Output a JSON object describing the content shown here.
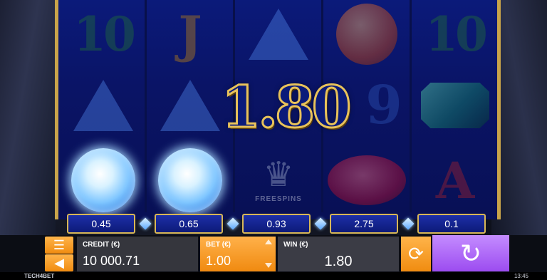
{
  "reels": [
    [
      "10",
      "gem-triangle-blue",
      "diamond"
    ],
    [
      "J",
      "gem-triangle-blue",
      "diamond"
    ],
    [
      "gem-triangle-blue",
      "",
      "crown-scatter"
    ],
    [
      "gem-round-orange",
      "9",
      "gem-oval-red"
    ],
    [
      "10",
      "gem-emerald-green",
      "A"
    ]
  ],
  "symbols": {
    "reel1_top": "10",
    "reel2_top": "J",
    "reel4_mid": "9",
    "reel5_top": "10",
    "reel5_bot": "A",
    "crown_text": "FREESPINS"
  },
  "win_display": "1.80",
  "reel_bets": [
    "0.45",
    "0.65",
    "0.93",
    "2.75",
    "0.1"
  ],
  "panel": {
    "credit_label": "CREDIT (€)",
    "credit_value": "10 000.71",
    "bet_label": "BET (€)",
    "bet_value": "1.00",
    "win_label": "WIN (€)",
    "win_value": "1.80"
  },
  "icons": {
    "menu": "☰",
    "sound": "◀",
    "autoplay": "⟳",
    "spin": "↻",
    "crown": "♛"
  },
  "footer": {
    "brand": "TECH4BET",
    "time": "13:45"
  },
  "colors": {
    "frame_gold": "#c9a44a",
    "reel_blue": "#0a1466",
    "accent_orange": "#f08c10",
    "spin_purple": "#9c4cf0"
  }
}
